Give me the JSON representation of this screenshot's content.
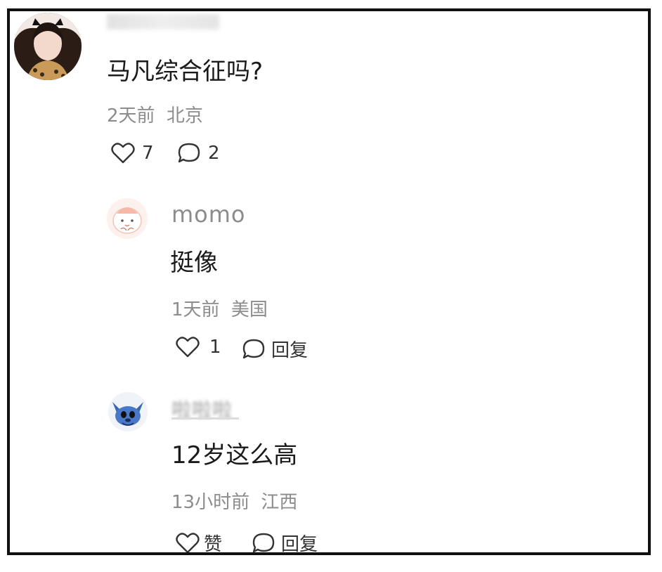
{
  "main_comment": {
    "text": "马凡综合征吗?",
    "time": "2天前",
    "location": "北京",
    "likes": "7",
    "replies": "2"
  },
  "replies": [
    {
      "username": "momo",
      "text": "挺像",
      "time": "1天前",
      "location": "美国",
      "likes": "1",
      "reply_label": "回复"
    },
    {
      "username": "啦啦啦",
      "text": "12岁这么高",
      "time": "13小时前",
      "location": "江西",
      "like_label": "赞",
      "reply_label": "回复"
    }
  ],
  "icons": {
    "like": "heart-icon",
    "comment": "comment-bubble-icon"
  },
  "colors": {
    "text": "#1a1a1a",
    "meta": "#8c8c8c",
    "border": "#111111"
  }
}
